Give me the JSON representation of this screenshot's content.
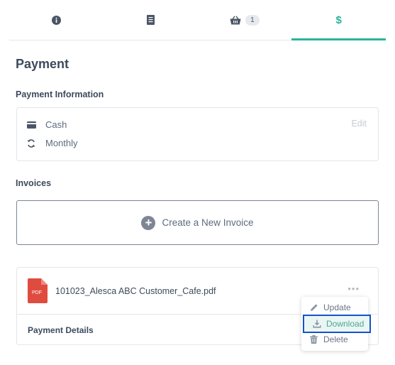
{
  "tabs": [
    {
      "icon": "info-icon"
    },
    {
      "icon": "receipt-icon"
    },
    {
      "icon": "basket-icon",
      "badge": "1"
    },
    {
      "icon": "dollar-icon",
      "label": "$",
      "active": true
    }
  ],
  "page": {
    "title": "Payment"
  },
  "payment_info": {
    "section_title": "Payment Information",
    "method": {
      "icon": "credit-card-icon",
      "label": "Cash"
    },
    "frequency": {
      "icon": "refresh-icon",
      "label": "Monthly"
    },
    "edit_label": "Edit"
  },
  "invoices": {
    "section_title": "Invoices",
    "create_label": "Create a New Invoice",
    "file": {
      "icon": "pdf-file-icon",
      "icon_text": "PDF",
      "name": "101023_Alesca ABC Customer_Cafe.pdf"
    },
    "more_label": "•••",
    "details_label": "Payment Details"
  },
  "context_menu": {
    "items": [
      {
        "icon": "pencil-icon",
        "label": "Update"
      },
      {
        "icon": "download-icon",
        "label": "Download",
        "highlighted": true
      },
      {
        "icon": "trash-icon",
        "label": "Delete"
      }
    ]
  },
  "colors": {
    "accent": "#2bb39a",
    "highlight_border": "#1452c9",
    "pdf_red": "#e04b3f"
  }
}
